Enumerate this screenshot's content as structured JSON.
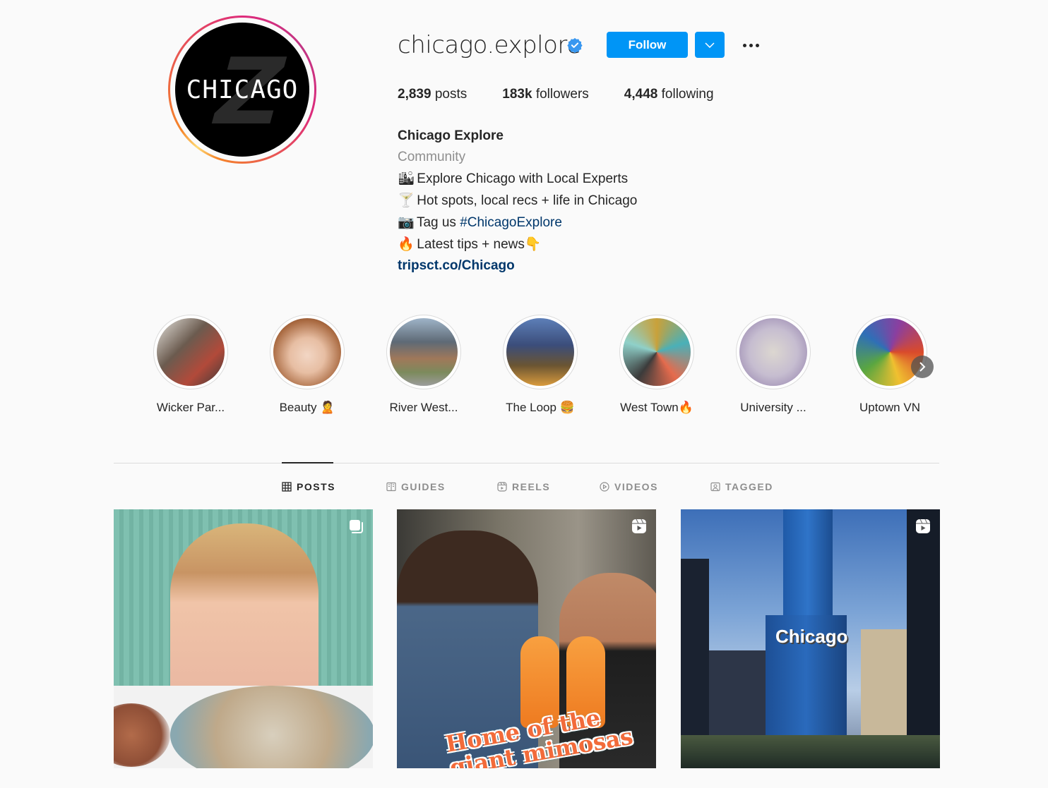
{
  "profile": {
    "username": "chicago.explore",
    "verified": true,
    "avatar_text": "CHICAGO",
    "follow_label": "Follow",
    "stats": {
      "posts_count": "2,839",
      "posts_label": "posts",
      "followers_count": "183k",
      "followers_label": "followers",
      "following_count": "4,448",
      "following_label": "following"
    },
    "bio": {
      "name": "Chicago Explore",
      "category": "Community",
      "lines": [
        {
          "emoji": "🏙",
          "text": "Explore Chicago with Local Experts"
        },
        {
          "emoji": "🍸",
          "text": "Hot spots, local recs + life in Chicago"
        },
        {
          "emoji": "📷",
          "text_prefix": "Tag us ",
          "hashtag": "#ChicagoExplore"
        },
        {
          "emoji": "🔥",
          "text": "Latest tips + news",
          "emoji_suffix": "👇"
        }
      ],
      "link": "tripsct.co/Chicago"
    },
    "accent_color": "#0095f6"
  },
  "highlights": [
    {
      "label": "Wicker Par..."
    },
    {
      "label": "Beauty 🙎"
    },
    {
      "label": "River West..."
    },
    {
      "label": "The Loop 🍔"
    },
    {
      "label": "West Town🔥"
    },
    {
      "label": "University ..."
    },
    {
      "label": "Uptown VN"
    }
  ],
  "tabs": [
    {
      "label": "POSTS",
      "icon": "grid-icon",
      "active": true
    },
    {
      "label": "GUIDES",
      "icon": "guide-icon",
      "active": false
    },
    {
      "label": "REELS",
      "icon": "reels-icon",
      "active": false
    },
    {
      "label": "VIDEOS",
      "icon": "video-icon",
      "active": false
    },
    {
      "label": "TAGGED",
      "icon": "tagged-icon",
      "active": false
    }
  ],
  "posts": [
    {
      "type": "carousel",
      "icon": "carousel-icon",
      "overlay_text": ""
    },
    {
      "type": "reel",
      "icon": "reels-icon",
      "overlay_text": "Home of the giant mimosas"
    },
    {
      "type": "reel",
      "icon": "reels-icon",
      "overlay_text": "Chicago"
    }
  ]
}
